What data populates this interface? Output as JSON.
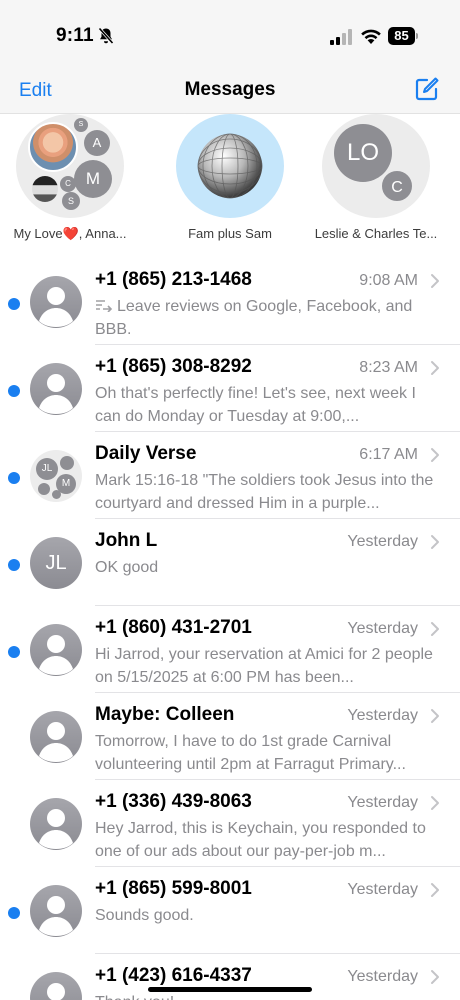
{
  "status_bar": {
    "time": "9:11",
    "battery": "85"
  },
  "nav": {
    "edit": "Edit",
    "title": "Messages"
  },
  "pinned": [
    {
      "label": "My Love❤️, Anna...",
      "minis": [
        "A",
        "M",
        "C",
        "S",
        "S"
      ]
    },
    {
      "label": "Fam plus Sam"
    },
    {
      "label": "Leslie  & Charles Te...",
      "initials": "LO",
      "minor": "C"
    }
  ],
  "conversations": [
    {
      "name": "+1 (865) 213-1468",
      "time": "9:08 AM",
      "preview": "Leave reviews on Google, Facebook, and BBB.",
      "unread": true,
      "reply": true
    },
    {
      "name": "+1 (865) 308-8292",
      "time": "8:23 AM",
      "preview": "Oh that's perfectly fine! Let's see, next week I can do Monday or Tuesday at 9:00,...",
      "unread": true
    },
    {
      "name": "Daily Verse",
      "time": "6:17 AM",
      "preview": "Mark 15:16-18 \"The soldiers took Jesus into the courtyard and dressed Him in a purple...",
      "unread": true,
      "group": true,
      "group_initials": "JL",
      "group_mini": "M"
    },
    {
      "name": "John L",
      "time": "Yesterday",
      "preview": "OK good",
      "unread": true,
      "initials": "JL"
    },
    {
      "name": "+1 (860) 431-2701",
      "time": "Yesterday",
      "preview": "Hi Jarrod,  your reservation at Amici for 2 people on 5/15/2025 at 6:00 PM has been...",
      "unread": true
    },
    {
      "name": "Maybe: Colleen",
      "time": "Yesterday",
      "preview": "Tomorrow, I have to do 1st grade Carnival volunteering until 2pm at Farragut Primary...",
      "unread": false
    },
    {
      "name": "+1 (336) 439-8063",
      "time": "Yesterday",
      "preview": "Hey Jarrod, this is Keychain, you responded to one of our ads about our pay-per-job m...",
      "unread": false
    },
    {
      "name": "+1 (865) 599-8001",
      "time": "Yesterday",
      "preview": "Sounds good.",
      "unread": true
    },
    {
      "name": "+1 (423) 616-4337",
      "time": "Yesterday",
      "preview": "Thank you!",
      "unread": false
    }
  ],
  "colors": {
    "accent": "#1a7ff0",
    "secondary_text": "#8a8a8e",
    "unread": "#1a7ff0"
  },
  "icons": [
    "bell-slash-icon",
    "cellular-signal-icon",
    "wifi-icon",
    "battery-icon",
    "compose-icon",
    "chevron-right-icon",
    "person-icon",
    "disco-ball-icon"
  ]
}
